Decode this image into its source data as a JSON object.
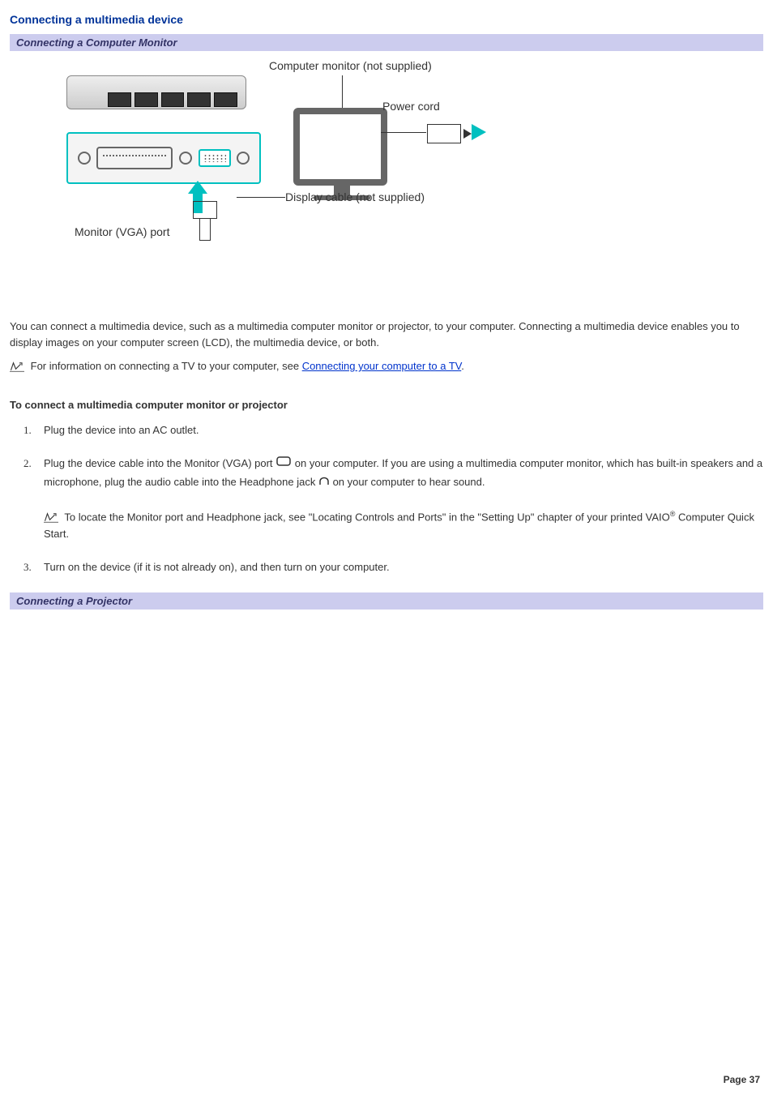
{
  "title": "Connecting a multimedia device",
  "section1": "Connecting a Computer Monitor",
  "diagram": {
    "monitor_label": "Computer monitor (not supplied)",
    "power_label": "Power cord",
    "display_label": "Display cable (not supplied)",
    "vga_label": "Monitor (VGA) port"
  },
  "para1": "You can connect a multimedia device, such as a multimedia computer monitor or projector, to your computer. Connecting a multimedia device enables you to display images on your computer screen (LCD), the multimedia device, or both.",
  "note1_before": "For information on connecting a TV to your computer, see ",
  "note1_link": "Connecting your computer to a TV",
  "note1_after": ".",
  "subheading": "To connect a multimedia computer monitor or projector",
  "step1": "Plug the device into an AC outlet.",
  "step2a": "Plug the device cable into the Monitor (VGA) port ",
  "step2b": " on your computer. If you are using a multimedia computer monitor, which has built-in speakers and a microphone, plug the audio cable into the Headphone jack ",
  "step2c": " on your computer to hear sound.",
  "step2_note_a": "To locate the Monitor port and Headphone jack, see \"Locating Controls and Ports\" in the \"Setting Up\" chapter of your printed VAIO",
  "step2_note_b": " Computer Quick Start.",
  "step3": "Turn on the device (if it is not already on), and then turn on your computer.",
  "section2": "Connecting a Projector",
  "page_number": "Page 37"
}
